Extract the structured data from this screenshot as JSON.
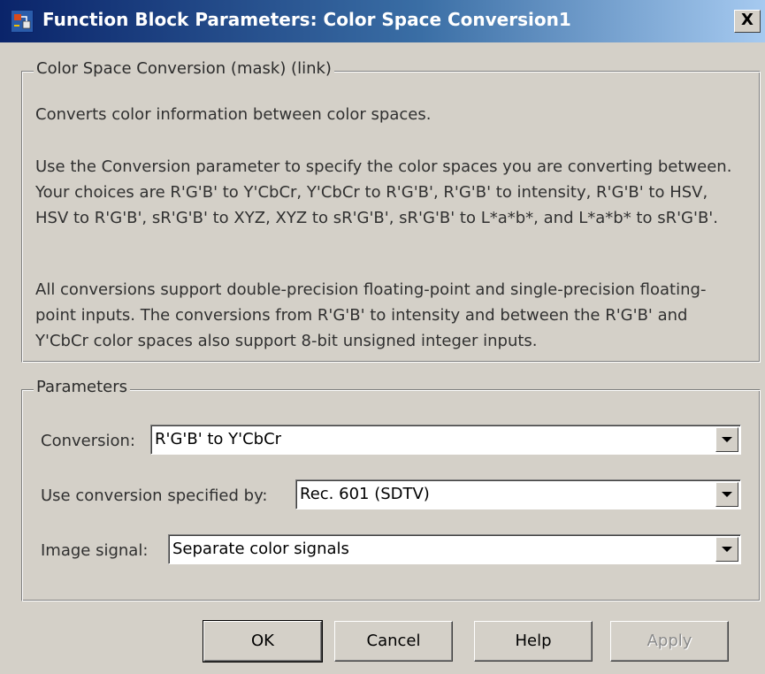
{
  "window": {
    "title": "Function Block Parameters: Color Space Conversion1",
    "close_label": "X"
  },
  "description_group": {
    "legend": "Color Space Conversion (mask) (link)",
    "paragraphs": [
      "Converts color information between color spaces.",
      "Use the Conversion parameter to specify the color spaces you are converting between. Your choices are R'G'B' to Y'CbCr, Y'CbCr to R'G'B', R'G'B' to intensity, R'G'B' to HSV, HSV to R'G'B', sR'G'B' to XYZ, XYZ to sR'G'B', sR'G'B' to L*a*b*, and L*a*b* to sR'G'B'.",
      "All conversions support double-precision floating-point and single-precision floating-point inputs. The conversions from R'G'B' to intensity and between the R'G'B' and Y'CbCr color spaces also support 8-bit unsigned integer inputs."
    ]
  },
  "parameters_group": {
    "legend": "Parameters",
    "conversion": {
      "label": "Conversion:",
      "value": "R'G'B' to Y'CbCr"
    },
    "conversion_spec": {
      "label": "Use conversion specified by:",
      "value": "Rec. 601 (SDTV)"
    },
    "image_signal": {
      "label": "Image signal:",
      "value": "Separate color signals"
    }
  },
  "buttons": {
    "ok": "OK",
    "cancel": "Cancel",
    "help": "Help",
    "apply": "Apply"
  },
  "icons": {
    "window_icon": "simulink-block-icon",
    "dropdown_icon": "chevron-down-icon"
  },
  "colors": {
    "title_bar_start": "#0a246a",
    "title_bar_end": "#a6caf0",
    "dialog_background": "#d4d0c8",
    "disabled_text": "#8a8a8a"
  }
}
